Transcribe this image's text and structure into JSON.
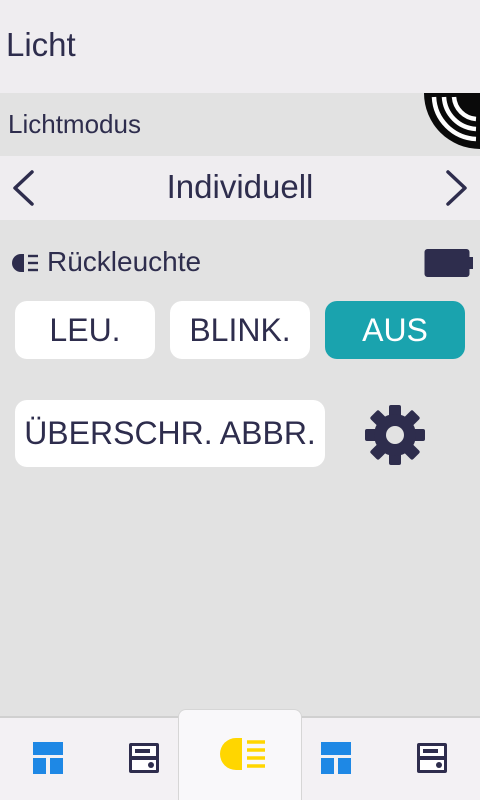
{
  "header": {
    "title": "Licht"
  },
  "section": {
    "label": "Lichtmodus"
  },
  "mode": {
    "value": "Individuell"
  },
  "rear_light": {
    "label": "Rückleuchte",
    "buttons": {
      "leu": "LEU.",
      "blink": "BLINK.",
      "aus": "AUS"
    },
    "active_button": "AUS",
    "abbr_button": "ÜBERSCHR. ABBR."
  },
  "colors": {
    "accent": "#1aa3ae",
    "text": "#2e2d4d",
    "icon_blue": "#1e88e5",
    "lamp_yellow": "#ffd600"
  },
  "icons": {
    "signal": "signal-arcs-icon",
    "prev": "chevron-left-icon",
    "next": "chevron-right-icon",
    "lamp": "rear-lamp-icon",
    "battery": "battery-icon",
    "gear": "gear-icon"
  },
  "bottom_nav": {
    "tabs": [
      "panel-layout-icon",
      "device-sliders-icon",
      "headlight-icon",
      "panel-layout-icon",
      "device-sliders-icon"
    ],
    "active_index": 2
  }
}
